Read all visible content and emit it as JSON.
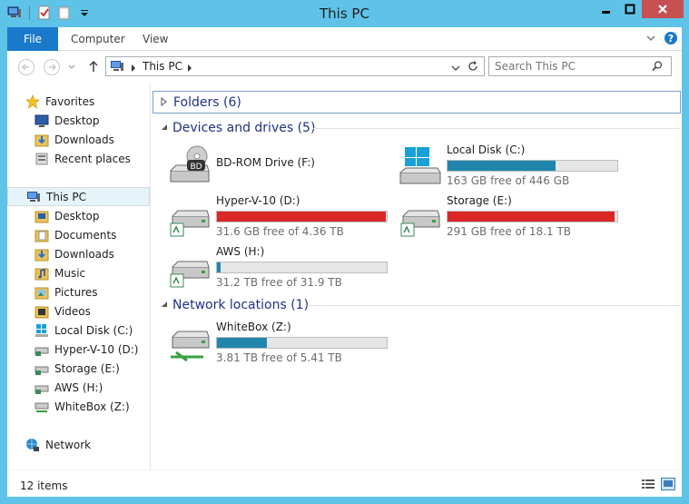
{
  "window": {
    "title": "This PC"
  },
  "ribbon": {
    "tabs": [
      "File",
      "Computer",
      "View"
    ]
  },
  "address": {
    "path": "This PC"
  },
  "search": {
    "placeholder": "Search This PC"
  },
  "sidebar": {
    "favorites": {
      "label": "Favorites",
      "items": [
        "Desktop",
        "Downloads",
        "Recent places"
      ]
    },
    "thispc": {
      "label": "This PC",
      "items": [
        "Desktop",
        "Documents",
        "Downloads",
        "Music",
        "Pictures",
        "Videos",
        "Local Disk (C:)",
        "Hyper-V-10 (D:)",
        "Storage (E:)",
        "AWS (H:)",
        "WhiteBox (Z:)"
      ]
    },
    "network": {
      "label": "Network"
    }
  },
  "groups": {
    "folders": "Folders (6)",
    "devices": "Devices and drives (5)",
    "network": "Network locations (1)"
  },
  "drives": [
    {
      "name": "BD-ROM Drive (F:)"
    },
    {
      "name": "Local Disk (C:)",
      "free": "163 GB free of 446 GB",
      "used_fraction": 0.635
    },
    {
      "name": "Hyper-V-10 (D:)",
      "free": "31.6 GB free of 4.36 TB",
      "used_fraction": 0.993
    },
    {
      "name": "Storage (E:)",
      "free": "291 GB free of 18.1 TB",
      "used_fraction": 0.984
    },
    {
      "name": "AWS (H:)",
      "free": "31.2 TB free of 31.9 TB",
      "used_fraction": 0.022
    }
  ],
  "network_locations": [
    {
      "name": "WhiteBox (Z:)",
      "free": "3.81 TB free of 5.41 TB",
      "used_fraction": 0.296
    }
  ],
  "status": {
    "count": "12 items"
  },
  "colors": {
    "accent": "#1979ca",
    "frame": "#5fc3e8",
    "bar_ok": "#2086ac",
    "bar_full": "#da2626",
    "group_text": "#1e3287"
  }
}
